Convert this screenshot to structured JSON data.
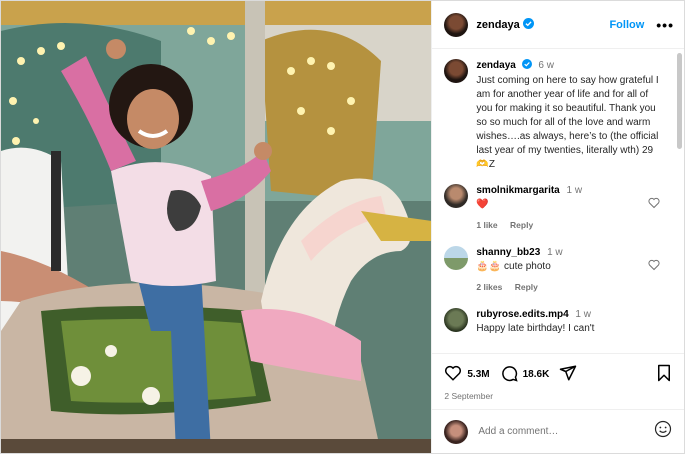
{
  "header": {
    "username": "zendaya",
    "follow_label": "Follow",
    "more_label": "•••"
  },
  "caption": {
    "username": "zendaya",
    "time": "6 w",
    "text": "Just coming on here to say how grateful I am for another year of life and for all of you for making it so beautiful. Thank you so so much for all of the love and warm wishes….as always, here’s to (the official last year of my twenties, literally wth) 29",
    "signoff": "🫶Z"
  },
  "comments": [
    {
      "username": "smolnikmargarita",
      "time": "1 w",
      "text": "❤️",
      "likes": "1 like",
      "reply": "Reply"
    },
    {
      "username": "shanny_bb23",
      "time": "1 w",
      "text": "🎂🎂 cute photo",
      "likes": "2 likes",
      "reply": "Reply"
    },
    {
      "username": "rubyrose.edits.mp4",
      "time": "1 w",
      "text": "Happy late birthday! I can't"
    }
  ],
  "actions": {
    "likes": "5.3M",
    "comments": "18.6K",
    "date": "2 September"
  },
  "add_comment": {
    "placeholder": "Add a comment…"
  },
  "colors": {
    "accent": "#0095f6",
    "heart": "#ed4956"
  }
}
